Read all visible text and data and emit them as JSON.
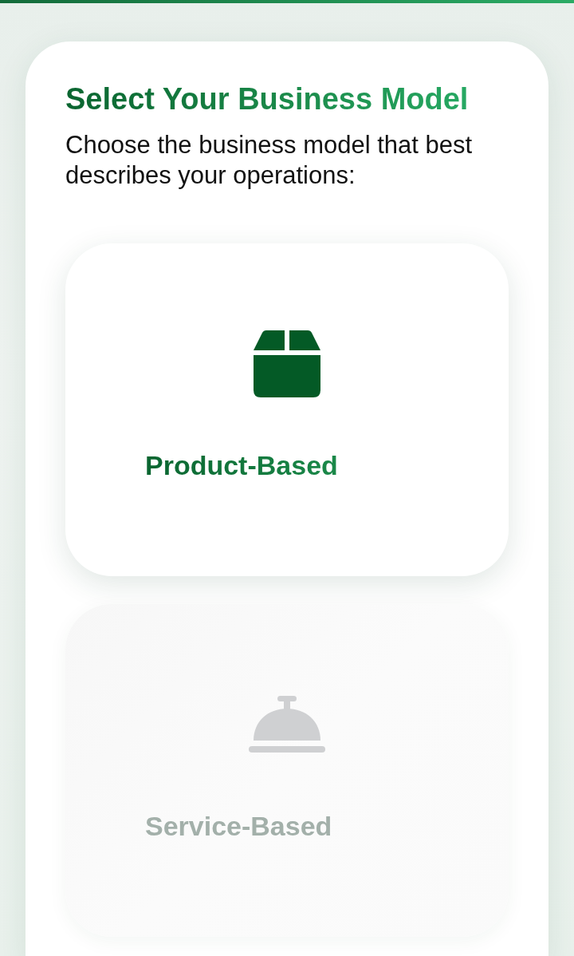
{
  "title": "Select Your Business Model",
  "subtitle": "Choose the business model that best describes your operations:",
  "options": [
    {
      "kind": "product",
      "label": "Product-Based",
      "selected": true
    },
    {
      "kind": "service",
      "label": "Service-Based",
      "selected": false
    }
  ]
}
